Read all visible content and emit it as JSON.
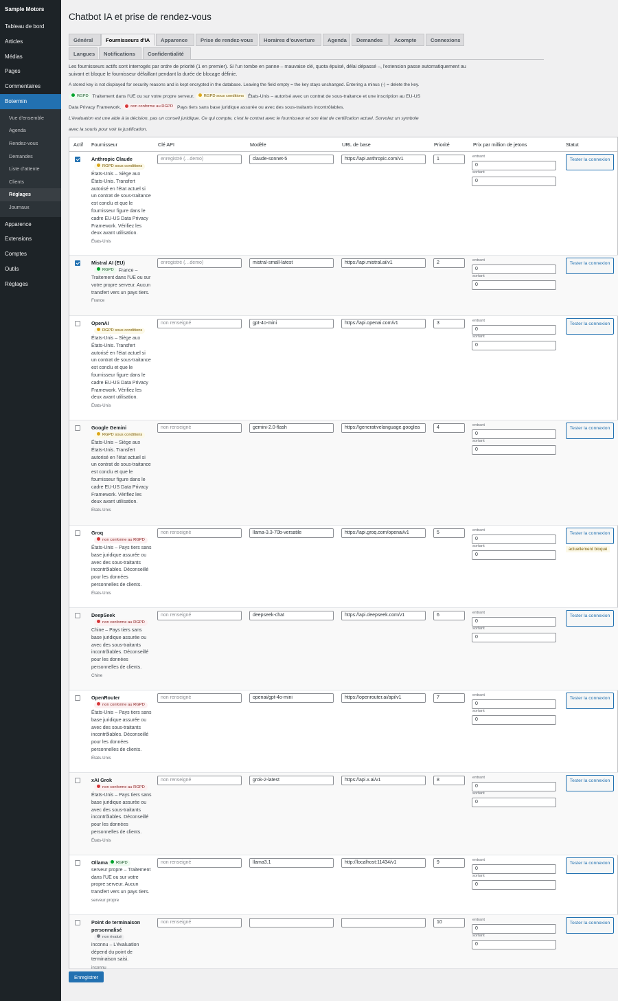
{
  "sidebar": {
    "brand": "Sample Motors",
    "items": [
      "Tableau de bord",
      "Articles",
      "Médias",
      "Pages",
      "Commentaires",
      "Botermin"
    ],
    "submenu": [
      "Vue d'ensemble",
      "Agenda",
      "Rendez-vous",
      "Demandes",
      "Liste d'attente",
      "Clients",
      "Réglages",
      "Journaux"
    ],
    "items_after": [
      "Apparence",
      "Extensions",
      "Comptes",
      "Outils",
      "Réglages"
    ]
  },
  "page_title": "Chatbot IA et prise de rendez-vous",
  "tabs": [
    "Général",
    "Fournisseurs d'IA",
    "Apparence",
    "Prise de rendez-vous",
    "Horaires d'ouverture",
    "Agenda",
    "Demandes",
    "Acompte",
    "Connexions",
    "Langues",
    "Notifications",
    "Confidentialité"
  ],
  "active_tab": "Fournisseurs d'IA",
  "intro1": "Les fournisseurs actifs sont interrogés par ordre de priorité (1 en premier). Si l'un tombe en panne – mauvaise clé, quota épuisé, délai dépassé –, l'extension passe automatiquement au suivant et bloque le fournisseur défaillant pendant la durée de blocage définie.",
  "intro2": "A stored key is not displayed for security reasons and is kept encrypted in the database. Leaving the field empty = the key stays unchanged. Entering a minus (-) = delete the key.",
  "legend": {
    "green_badge": "RGPD",
    "green_text": "Traitement dans l'UE ou sur votre propre serveur.",
    "amber_badge": "RGPD sous conditions",
    "amber_text": "États-Unis – autorisé avec un contrat de sous-traitance et une inscription au EU-US Data Privacy Framework.",
    "red_badge": "non conforme au RGPD",
    "red_text": "Pays tiers sans base juridique assurée ou avec des sous-traitants incontrôlables."
  },
  "disclaimer": "L'évaluation est une aide à la décision, pas un conseil juridique. Ce qui compte, c'est le contrat avec le fournisseur et son état de certification actuel. Survolez un symbole avec la souris pour voir la justification.",
  "columns": {
    "active": "Actif",
    "provider": "Fournisseur",
    "api_key": "Clé API",
    "model": "Modèle",
    "base_url": "URL de base",
    "priority": "Priorité",
    "price": "Prix par million de jetons",
    "status": "Statut"
  },
  "labels": {
    "input": "entrant",
    "output": "sortant",
    "test": "Tester la connexion",
    "blocked": "actuellement bloqué"
  },
  "providers": [
    {
      "name": "Anthropic Claude",
      "active": true,
      "badge": "RGPD sous conditions",
      "badge_type": "amber",
      "desc": "États-Unis – Siège aux États-Unis. Transfert autorisé en l'état actuel si un contrat de sous-traitance est conclu et que le fournisseur figure dans le cadre EU-US Data Privacy Framework. Vérifiez les deux avant utilisation.",
      "country": "États-Unis",
      "api_key": "enregistré (…demo)",
      "model": "claude-sonnet-5",
      "base_url": "https://api.anthropic.com/v1",
      "priority": "1",
      "price_in": "0",
      "price_out": "0",
      "blocked": false
    },
    {
      "name": "Mistral AI (EU)",
      "active": true,
      "badge": "RGPD",
      "badge_type": "green",
      "desc": "France – Traitement dans l'UE ou sur votre propre serveur. Aucun transfert vers un pays tiers.",
      "country": "France",
      "api_key": "enregistré (…demo)",
      "model": "mistral-small-latest",
      "base_url": "https://api.mistral.ai/v1",
      "priority": "2",
      "price_in": "0",
      "price_out": "0",
      "blocked": false
    },
    {
      "name": "OpenAI",
      "active": false,
      "badge": "RGPD sous conditions",
      "badge_type": "amber",
      "desc": "États-Unis – Siège aux États-Unis. Transfert autorisé en l'état actuel si un contrat de sous-traitance est conclu et que le fournisseur figure dans le cadre EU-US Data Privacy Framework. Vérifiez les deux avant utilisation.",
      "country": "États-Unis",
      "api_key": "non renseigné",
      "model": "gpt-4o-mini",
      "base_url": "https://api.openai.com/v1",
      "priority": "3",
      "price_in": "0",
      "price_out": "0",
      "blocked": false
    },
    {
      "name": "Google Gemini",
      "active": false,
      "badge": "RGPD sous conditions",
      "badge_type": "amber",
      "desc": "États-Unis – Siège aux États-Unis. Transfert autorisé en l'état actuel si un contrat de sous-traitance est conclu et que le fournisseur figure dans le cadre EU-US Data Privacy Framework. Vérifiez les deux avant utilisation.",
      "country": "États-Unis",
      "api_key": "non renseigné",
      "model": "gemini-2.0-flash",
      "base_url": "https://generativelanguage.googlea",
      "priority": "4",
      "price_in": "0",
      "price_out": "0",
      "blocked": false
    },
    {
      "name": "Groq",
      "active": false,
      "badge": "non conforme au RGPD",
      "badge_type": "red",
      "desc": "États-Unis – Pays tiers sans base juridique assurée ou avec des sous-traitants incontrôlables. Déconseillé pour les données personnelles de clients.",
      "country": "États-Unis",
      "api_key": "non renseigné",
      "model": "llama-3.3-70b-versatile",
      "base_url": "https://api.groq.com/openai/v1",
      "priority": "5",
      "price_in": "0",
      "price_out": "0",
      "blocked": true
    },
    {
      "name": "DeepSeek",
      "active": false,
      "badge": "non conforme au RGPD",
      "badge_type": "red",
      "desc": "Chine – Pays tiers sans base juridique assurée ou avec des sous-traitants incontrôlables. Déconseillé pour les données personnelles de clients.",
      "country": "Chine",
      "api_key": "non renseigné",
      "model": "deepseek-chat",
      "base_url": "https://api.deepseek.com/v1",
      "priority": "6",
      "price_in": "0",
      "price_out": "0",
      "blocked": false
    },
    {
      "name": "OpenRouter",
      "active": false,
      "badge": "non conforme au RGPD",
      "badge_type": "red",
      "desc": "États-Unis – Pays tiers sans base juridique assurée ou avec des sous-traitants incontrôlables. Déconseillé pour les données personnelles de clients.",
      "country": "États-Unis",
      "api_key": "non renseigné",
      "model": "openai/gpt-4o-mini",
      "base_url": "https://openrouter.ai/api/v1",
      "priority": "7",
      "price_in": "0",
      "price_out": "0",
      "blocked": false
    },
    {
      "name": "xAI Grok",
      "active": false,
      "badge": "non conforme au RGPD",
      "badge_type": "red",
      "desc": "États-Unis – Pays tiers sans base juridique assurée ou avec des sous-traitants incontrôlables. Déconseillé pour les données personnelles de clients.",
      "country": "États-Unis",
      "api_key": "non renseigné",
      "model": "grok-2-latest",
      "base_url": "https://api.x.ai/v1",
      "priority": "8",
      "price_in": "0",
      "price_out": "0",
      "blocked": false
    },
    {
      "name": "Ollama / local",
      "active": false,
      "badge": "RGPD",
      "badge_type": "green",
      "desc": "serveur propre – Traitement dans l'UE ou sur votre propre serveur. Aucun transfert vers un pays tiers.",
      "country": "serveur propre",
      "api_key": "non renseigné",
      "model": "llama3.1",
      "base_url": "http://localhost:11434/v1",
      "priority": "9",
      "price_in": "0",
      "price_out": "0",
      "blocked": false
    },
    {
      "name": "Point de terminaison personnalisé",
      "active": false,
      "badge": "non évalué",
      "badge_type": "grey",
      "desc": "inconnu – L'évaluation dépend du point de terminaison saisi.",
      "country": "inconnu",
      "api_key": "non renseigné",
      "model": "",
      "base_url": "",
      "priority": "10",
      "price_in": "0",
      "price_out": "0",
      "blocked": false
    }
  ],
  "save_label": "Enregistrer"
}
